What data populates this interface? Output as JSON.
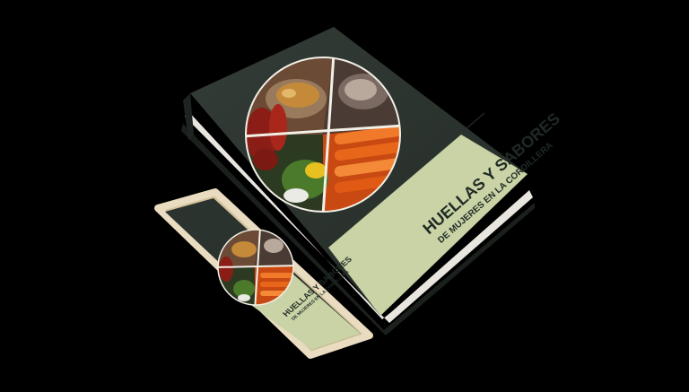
{
  "book": {
    "title": "HUELLAS Y SABORES",
    "subtitle": "DE MUJERES EN LA CORDILLERA"
  },
  "phone": {
    "title": "HUELLAS Y SABORES",
    "subtitle": "DE MUJERES EN LA CORDILLERA"
  },
  "colors": {
    "background": "#000000",
    "cover": "#2b332e",
    "spine_dark": "#1e2420",
    "band": "#c9d3a6",
    "phone_frame": "#d8c7a4",
    "text": "#1f2a24"
  },
  "icons": {
    "book_photo": "food-collage-photo",
    "phone_photo": "food-collage-photo"
  }
}
